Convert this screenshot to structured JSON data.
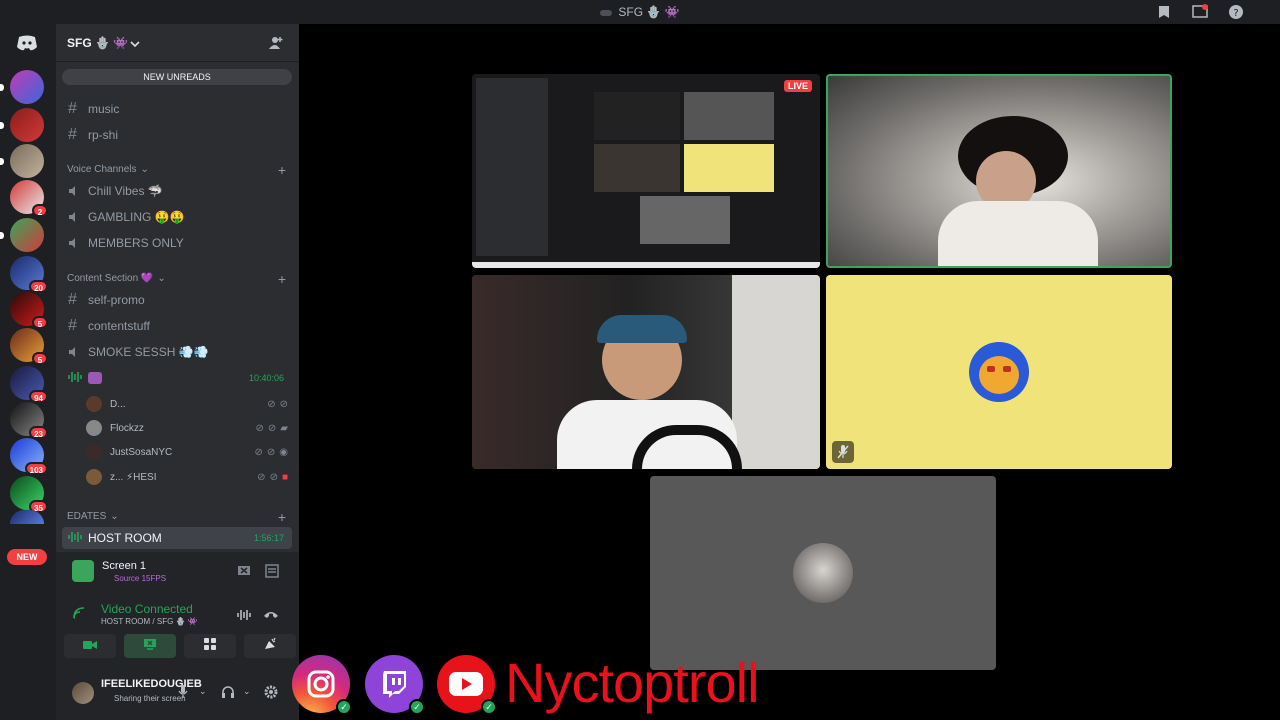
{
  "window": {
    "title": "SFG 🪬 👾"
  },
  "guild": {
    "name": "SFG 🪬 👾",
    "new_unreads": "NEW UNREADS"
  },
  "server_list": {
    "badges": [
      "2",
      "20",
      "5",
      "5",
      "94",
      "23",
      "103",
      "35"
    ],
    "new_label": "NEW"
  },
  "channels": {
    "text_top": [
      {
        "name": "music"
      },
      {
        "name": "rp-shi"
      }
    ],
    "voice_category": "Voice Channels",
    "voice": [
      {
        "name": "Chill Vibes 🦈"
      },
      {
        "name": "GAMBLING 🤑🤑"
      },
      {
        "name": "MEMBERS ONLY"
      }
    ],
    "content_category": "Content Section 💜",
    "content": [
      {
        "name": "self-promo"
      },
      {
        "name": "contentstuff"
      },
      {
        "name": "SMOKE SESSH 💨💨"
      }
    ],
    "active_vc_timer": "10:40:06",
    "vc_users": [
      {
        "name": "D..."
      },
      {
        "name": "Flockzz"
      },
      {
        "name": "JustSosaNYC"
      },
      {
        "name": "z... ⚡HESI"
      }
    ],
    "edates_category": "EDATES",
    "host_room": "HOST ROOM",
    "host_timer": "1:56:17"
  },
  "screen_panel": {
    "title": "Screen 1",
    "subtitle": "Source 15FPS"
  },
  "voice_panel": {
    "status": "Video Connected",
    "location": "HOST ROOM / SFG 🪬 👾"
  },
  "user_panel": {
    "username": "IFEELIKEDOUGIEB",
    "status": "Sharing their screen"
  },
  "stage": {
    "live_label": "LIVE"
  },
  "overlay": {
    "brand": "Nyctoptroll"
  },
  "colors": {
    "accent_green": "#23a55a",
    "live_red": "#f23f42",
    "brand_red": "#e8121b",
    "yellow_tile": "#f0e37a"
  }
}
